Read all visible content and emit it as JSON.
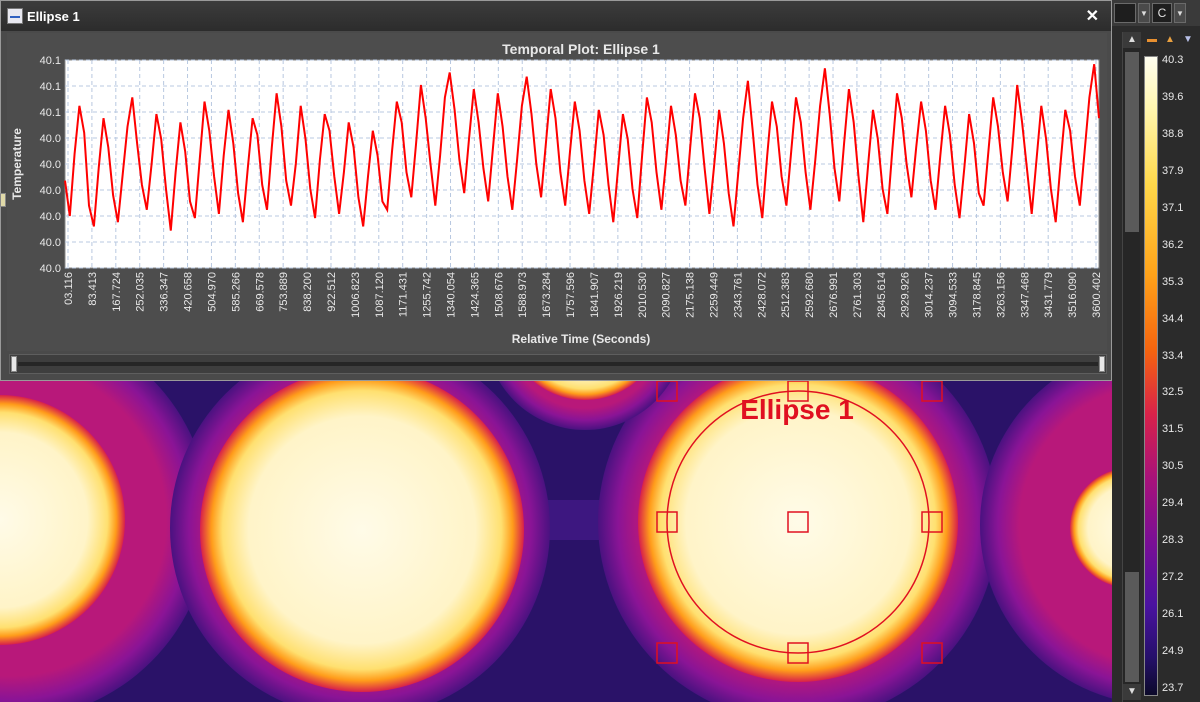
{
  "window": {
    "title": "Ellipse 1",
    "close_label": "✕"
  },
  "top_bar": {
    "select_label": "C"
  },
  "chart_data": {
    "type": "line",
    "title": "Temporal Plot: Ellipse 1",
    "xlabel": "Relative Time (Seconds)",
    "ylabel": "Temperature",
    "xlim": [
      3.116,
      3600.402
    ],
    "x_ticks": [
      "03.116",
      "83.413",
      "167.724",
      "252.035",
      "336.347",
      "420.658",
      "504.970",
      "585.266",
      "669.578",
      "753.889",
      "838.200",
      "922.512",
      "1006.823",
      "1087.120",
      "1171.431",
      "1255.742",
      "1340.054",
      "1424.365",
      "1508.676",
      "1588.973",
      "1673.284",
      "1757.596",
      "1841.907",
      "1926.219",
      "2010.530",
      "2090.827",
      "2175.138",
      "2259.449",
      "2343.761",
      "2428.072",
      "2512.383",
      "2592.680",
      "2676.991",
      "2761.303",
      "2845.614",
      "2929.926",
      "3014.237",
      "3094.533",
      "3178.845",
      "3263.156",
      "3347.468",
      "3431.779",
      "3516.090",
      "3600.402"
    ],
    "y_ticks": [
      "40.1",
      "40.1",
      "40.1",
      "40.0",
      "40.0",
      "40.0",
      "40.0",
      "40.0",
      "40.0"
    ],
    "series": [
      {
        "color": "#ff0000",
        "x_start": 3.116,
        "x_end": 3600.402,
        "values": [
          0.42,
          0.25,
          0.55,
          0.78,
          0.65,
          0.3,
          0.2,
          0.48,
          0.72,
          0.58,
          0.35,
          0.22,
          0.45,
          0.68,
          0.82,
          0.6,
          0.4,
          0.28,
          0.5,
          0.74,
          0.62,
          0.38,
          0.18,
          0.46,
          0.7,
          0.56,
          0.32,
          0.24,
          0.52,
          0.8,
          0.66,
          0.44,
          0.26,
          0.54,
          0.76,
          0.6,
          0.36,
          0.22,
          0.48,
          0.72,
          0.64,
          0.4,
          0.28,
          0.58,
          0.84,
          0.68,
          0.42,
          0.3,
          0.5,
          0.78,
          0.62,
          0.38,
          0.24,
          0.52,
          0.74,
          0.66,
          0.44,
          0.26,
          0.46,
          0.7,
          0.58,
          0.34,
          0.2,
          0.44,
          0.66,
          0.54,
          0.32,
          0.28,
          0.56,
          0.8,
          0.7,
          0.46,
          0.34,
          0.6,
          0.88,
          0.72,
          0.5,
          0.3,
          0.54,
          0.82,
          0.94,
          0.76,
          0.52,
          0.36,
          0.62,
          0.86,
          0.7,
          0.48,
          0.32,
          0.58,
          0.84,
          0.68,
          0.44,
          0.28,
          0.52,
          0.78,
          0.92,
          0.74,
          0.5,
          0.34,
          0.6,
          0.86,
          0.72,
          0.46,
          0.3,
          0.56,
          0.8,
          0.66,
          0.42,
          0.26,
          0.5,
          0.76,
          0.64,
          0.4,
          0.22,
          0.48,
          0.74,
          0.62,
          0.38,
          0.24,
          0.54,
          0.82,
          0.7,
          0.46,
          0.28,
          0.52,
          0.78,
          0.64,
          0.42,
          0.3,
          0.58,
          0.84,
          0.72,
          0.48,
          0.26,
          0.5,
          0.76,
          0.6,
          0.36,
          0.2,
          0.46,
          0.72,
          0.9,
          0.66,
          0.4,
          0.24,
          0.54,
          0.8,
          0.68,
          0.44,
          0.3,
          0.56,
          0.82,
          0.7,
          0.46,
          0.28,
          0.52,
          0.78,
          0.96,
          0.74,
          0.48,
          0.32,
          0.6,
          0.86,
          0.7,
          0.44,
          0.22,
          0.5,
          0.76,
          0.62,
          0.38,
          0.26,
          0.56,
          0.84,
          0.72,
          0.5,
          0.34,
          0.58,
          0.8,
          0.66,
          0.42,
          0.28,
          0.54,
          0.78,
          0.64,
          0.4,
          0.24,
          0.48,
          0.74,
          0.6,
          0.36,
          0.3,
          0.56,
          0.82,
          0.68,
          0.46,
          0.32,
          0.58,
          0.88,
          0.7,
          0.48,
          0.26,
          0.52,
          0.78,
          0.62,
          0.38,
          0.22,
          0.5,
          0.76,
          0.66,
          0.44,
          0.3,
          0.56,
          0.82,
          0.98,
          0.72
        ]
      }
    ]
  },
  "colorbar": {
    "labels": [
      "40.3",
      "39.6",
      "38.8",
      "37.9",
      "37.1",
      "36.2",
      "35.3",
      "34.4",
      "33.4",
      "32.5",
      "31.5",
      "30.5",
      "29.4",
      "28.3",
      "27.2",
      "26.1",
      "24.9",
      "23.7"
    ]
  },
  "roi": {
    "label": "Ellipse 1",
    "color": "#e01020"
  }
}
